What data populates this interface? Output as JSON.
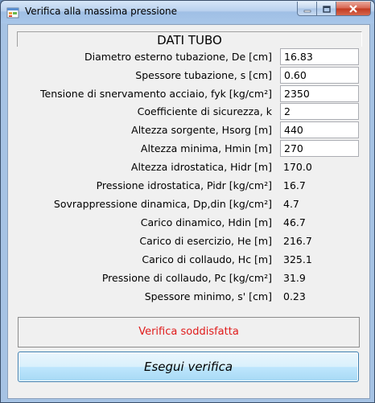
{
  "window": {
    "title": "Verifica alla massima pressione"
  },
  "section_title": "DATI TUBO",
  "inputs": [
    {
      "label": "Diametro esterno tubazione, De [cm]",
      "value": "16.83"
    },
    {
      "label": "Spessore tubazione, s [cm]",
      "value": "0.60"
    },
    {
      "label": "Tensione di snervamento acciaio, fyk [kg/cm²]",
      "value": "2350"
    },
    {
      "label": "Coefficiente di sicurezza, k",
      "value": "2"
    },
    {
      "label": "Altezza sorgente, Hsorg [m]",
      "value": "440"
    },
    {
      "label": "Altezza minima, Hmin [m]",
      "value": "270"
    }
  ],
  "outputs": [
    {
      "label": "Altezza idrostatica, Hidr [m]",
      "value": "170.0"
    },
    {
      "label": "Pressione idrostatica, Pidr [kg/cm²]",
      "value": "16.7"
    },
    {
      "label": "Sovrappressione dinamica, Dp,din [kg/cm²]",
      "value": "4.7"
    },
    {
      "label": "Carico dinamico, Hdin [m]",
      "value": "46.7"
    },
    {
      "label": "Carico di esercizio, He [m]",
      "value": "216.7"
    },
    {
      "label": "Carico di collaudo, Hc [m]",
      "value": "325.1"
    },
    {
      "label": "Pressione di collaudo, Pc [kg/cm²]",
      "value": "31.9"
    },
    {
      "label": "Spessore minimo, s' [cm]",
      "value": "0.23"
    }
  ],
  "result": {
    "text": "Verifica soddisfatta",
    "color": "#e01b1b"
  },
  "run_button": {
    "label": "Esegui verifica"
  },
  "icons": {
    "app": "app-form-icon",
    "minimize": "minimize-icon",
    "maximize": "maximize-icon",
    "close": "close-icon"
  }
}
